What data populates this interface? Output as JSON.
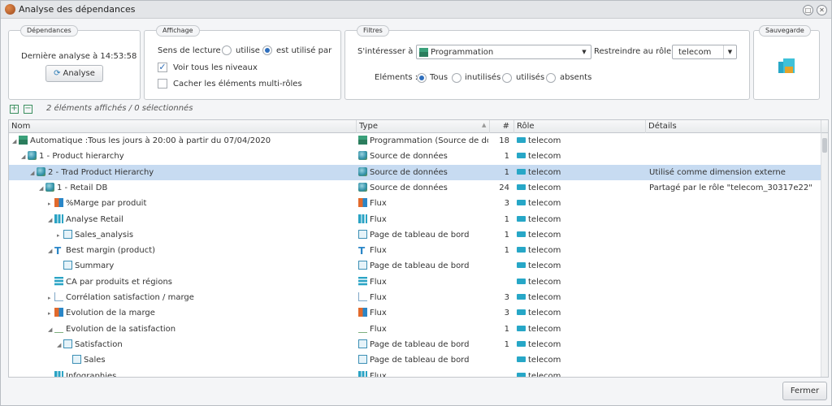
{
  "window": {
    "title": "Analyse des dépendances"
  },
  "dep": {
    "legend": "Dépendances",
    "last": "Dernière analyse à 14:53:58",
    "btn": "Analyse"
  },
  "aff": {
    "legend": "Affichage",
    "sens": "Sens de lecture :",
    "utilise": "utilise",
    "estutilise": "est utilisé par",
    "voir": "Voir tous les niveaux",
    "cacher": "Cacher les éléments multi-rôles"
  },
  "filtres": {
    "legend": "Filtres",
    "interesser": "S'intéresser à :",
    "prog": "Programmation",
    "restreindre": "Restreindre au rôle :",
    "role": "telecom",
    "elements": "Eléments :",
    "tous": "Tous",
    "inutilises": "inutilisés",
    "utilises": "utilisés",
    "absents": "absents"
  },
  "sauv": {
    "legend": "Sauvegarde"
  },
  "status": "2 éléments affichés / 0 sélectionnés",
  "cols": {
    "nom": "Nom",
    "type": "Type",
    "count": "#",
    "role": "Rôle",
    "details": "Détails"
  },
  "rows": [
    {
      "name": "Automatique :Tous les jours à 20:00 à partir du 07/04/2020",
      "type": "Programmation (Source de do...",
      "n": "18",
      "role": "telecom",
      "details": "",
      "icon": "schedule-icon"
    },
    {
      "name": "1 - Product hierarchy",
      "type": "Source de données",
      "n": "1",
      "role": "telecom",
      "details": "",
      "icon": "cube-icon"
    },
    {
      "name": "2 - Trad Product Hierarchy",
      "type": "Source de données",
      "n": "1",
      "role": "telecom",
      "details": "Utilisé comme dimension externe",
      "icon": "cube-icon"
    },
    {
      "name": "1 - Retail DB",
      "type": "Source de données",
      "n": "24",
      "role": "telecom",
      "details": "Partagé par le rôle \"telecom_30317e22\"",
      "icon": "cube-icon"
    },
    {
      "name": "%Marge par produit",
      "type": "Flux",
      "n": "3",
      "role": "telecom",
      "details": "",
      "icon": "flux-icon"
    },
    {
      "name": "Analyse Retail",
      "type": "Flux",
      "n": "1",
      "role": "telecom",
      "details": "",
      "icon": "bar-chart-icon"
    },
    {
      "name": "Sales_analysis",
      "type": "Page de tableau de bord",
      "n": "1",
      "role": "telecom",
      "details": "",
      "icon": "dashboard-icon"
    },
    {
      "name": "Best margin (product)",
      "type": "Flux",
      "n": "1",
      "role": "telecom",
      "details": "",
      "icon": "text-icon"
    },
    {
      "name": "Summary",
      "type": "Page de tableau de bord",
      "n": "",
      "role": "telecom",
      "details": "",
      "icon": "dashboard-icon"
    },
    {
      "name": "CA par produits et régions",
      "type": "Flux",
      "n": "",
      "role": "telecom",
      "details": "",
      "icon": "table-icon"
    },
    {
      "name": "Corrélation satisfaction / marge",
      "type": "Flux",
      "n": "3",
      "role": "telecom",
      "details": "",
      "icon": "scatter-icon"
    },
    {
      "name": "Evolution de la marge",
      "type": "Flux",
      "n": "3",
      "role": "telecom",
      "details": "",
      "icon": "flux-icon"
    },
    {
      "name": "Evolution de la satisfaction",
      "type": "Flux",
      "n": "1",
      "role": "telecom",
      "details": "",
      "icon": "line-chart-icon"
    },
    {
      "name": "Satisfaction",
      "type": "Page de tableau de bord",
      "n": "1",
      "role": "telecom",
      "details": "",
      "icon": "dashboard-icon"
    },
    {
      "name": "Sales",
      "type": "Page de tableau de bord",
      "n": "",
      "role": "telecom",
      "details": "",
      "icon": "dashboard-icon"
    },
    {
      "name": "Infographies",
      "type": "Flux",
      "n": "",
      "role": "telecom",
      "details": "",
      "icon": "bar-chart-icon"
    }
  ],
  "footer": {
    "fermer": "Fermer"
  }
}
